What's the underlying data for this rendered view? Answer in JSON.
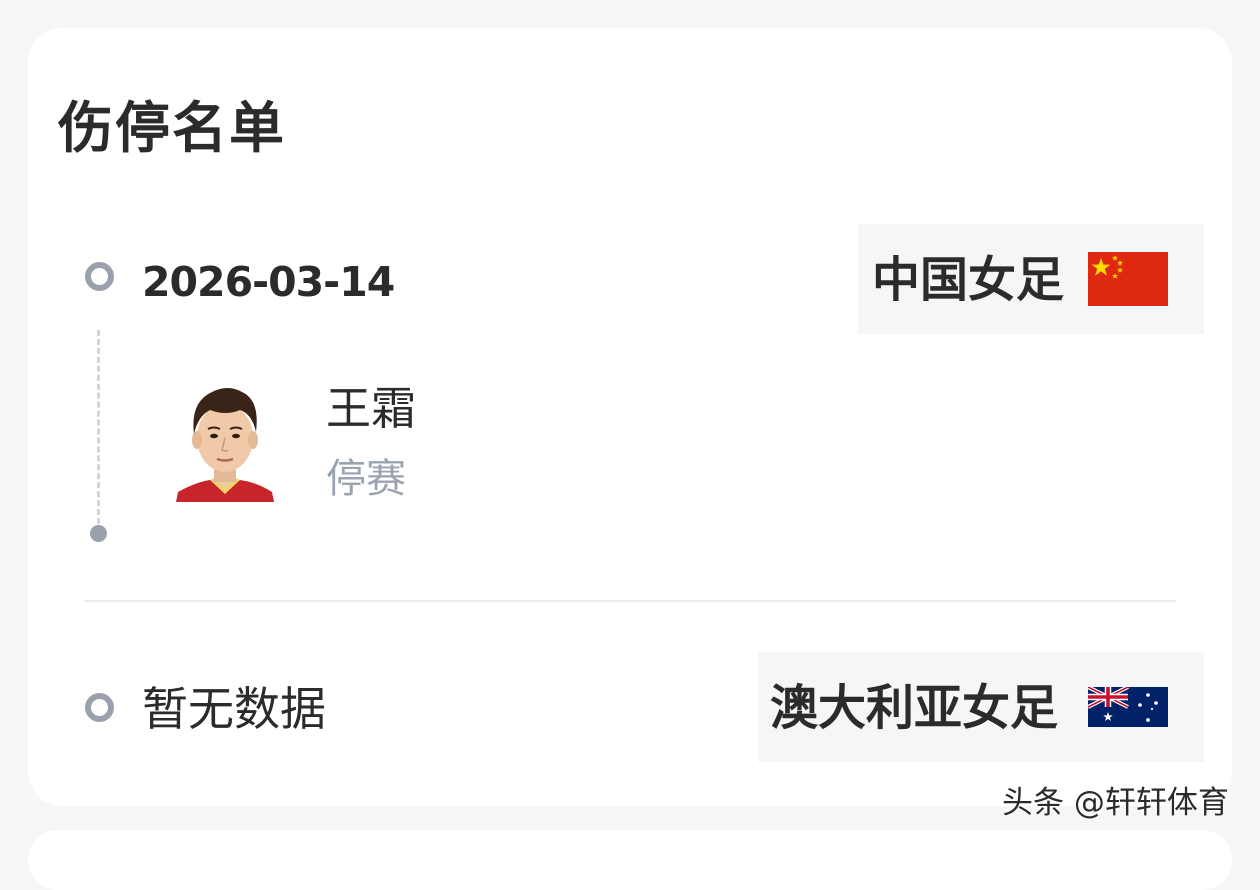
{
  "section": {
    "title": "伤停名单"
  },
  "entries": [
    {
      "date": "2026-03-14",
      "team": "中国女足",
      "flag_icon": "china-flag-icon",
      "players": [
        {
          "name": "王霜",
          "status": "停赛"
        }
      ]
    },
    {
      "empty_text": "暂无数据",
      "team": "澳大利亚女足",
      "flag_icon": "australia-flag-icon"
    }
  ],
  "watermark": "头条 @轩轩体育",
  "colors": {
    "text_primary": "#2b2b2b",
    "text_secondary": "#9ba2b0",
    "timeline": "#9aa1ad",
    "card_bg": "#ffffff",
    "page_bg": "#f5f6f8"
  }
}
